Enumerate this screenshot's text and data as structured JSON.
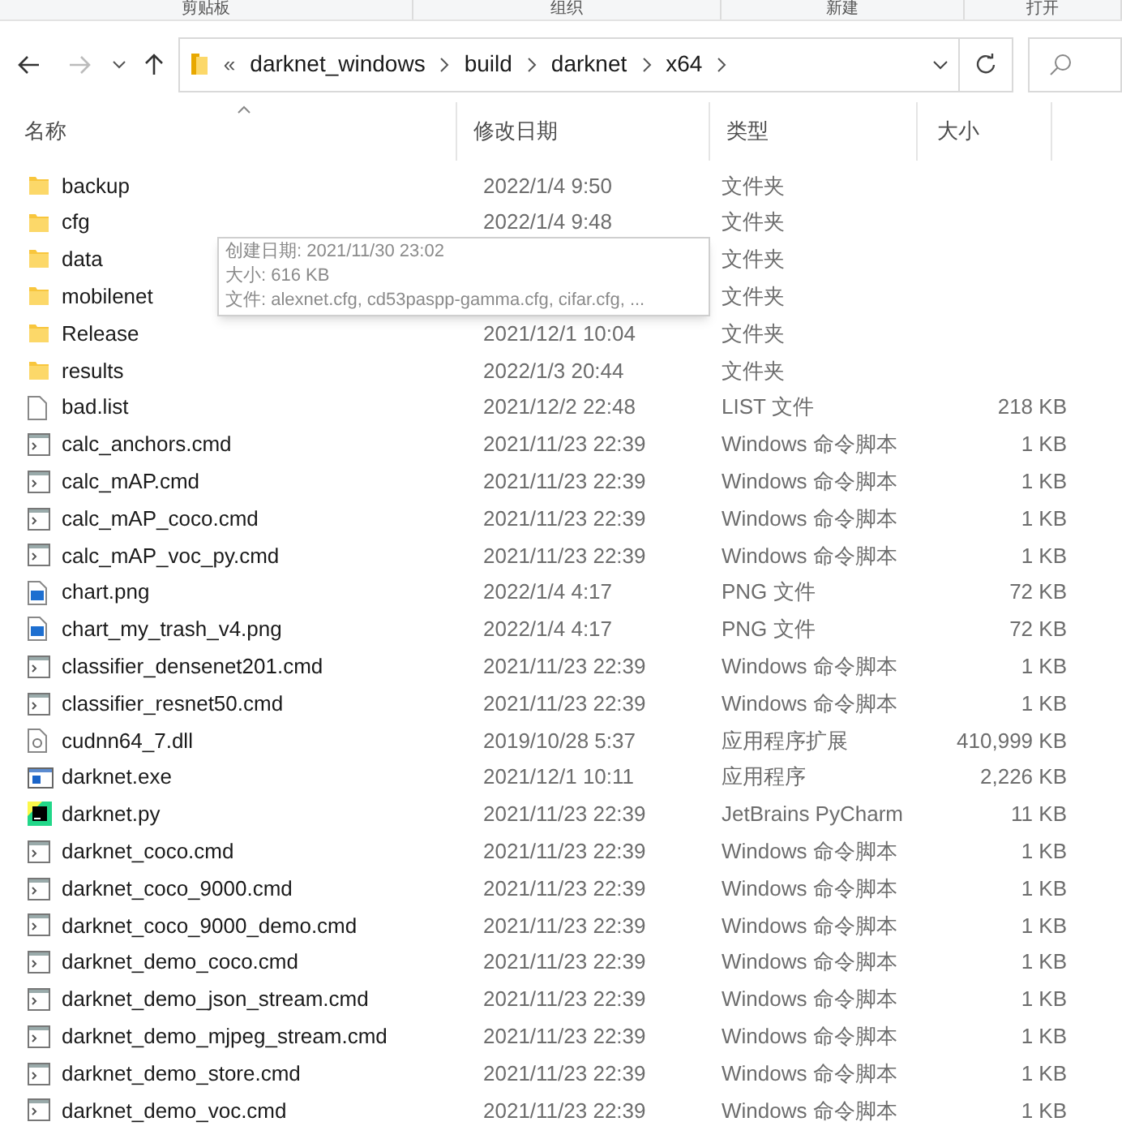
{
  "ribbon_groups": [
    "剪贴板",
    "组织",
    "新建",
    "打开"
  ],
  "address_bar": {
    "overflow": "«",
    "path": [
      "darknet_windows",
      "build",
      "darknet",
      "x64"
    ]
  },
  "columns": [
    "名称",
    "修改日期",
    "类型",
    "大小"
  ],
  "files": [
    {
      "kind": "folder",
      "name": "backup",
      "modified": "2022/1/4 9:50",
      "type": "文件夹"
    },
    {
      "kind": "folder",
      "name": "cfg",
      "modified": "2022/1/4 9:48",
      "type": "文件夹"
    },
    {
      "kind": "folder",
      "name": "data",
      "type": "文件夹"
    },
    {
      "kind": "folder",
      "name": "mobilenet",
      "type": "文件夹"
    },
    {
      "kind": "folder",
      "name": "Release",
      "modified": "2021/12/1 10:04",
      "type": "文件夹"
    },
    {
      "kind": "folder",
      "name": "results",
      "modified": "2022/1/3 20:44",
      "type": "文件夹"
    },
    {
      "kind": "file",
      "name": "bad.list",
      "modified": "2021/12/2 22:48",
      "type": "LIST 文件",
      "size": "218 KB"
    },
    {
      "kind": "script",
      "name": "calc_anchors.cmd",
      "modified": "2021/11/23 22:39",
      "type": "Windows 命令脚本",
      "size": "1 KB"
    },
    {
      "kind": "script",
      "name": "calc_mAP.cmd",
      "modified": "2021/11/23 22:39",
      "type": "Windows 命令脚本",
      "size": "1 KB"
    },
    {
      "kind": "script",
      "name": "calc_mAP_coco.cmd",
      "modified": "2021/11/23 22:39",
      "type": "Windows 命令脚本",
      "size": "1 KB"
    },
    {
      "kind": "script",
      "name": "calc_mAP_voc_py.cmd",
      "modified": "2021/11/23 22:39",
      "type": "Windows 命令脚本",
      "size": "1 KB"
    },
    {
      "kind": "image",
      "name": "chart.png",
      "modified": "2022/1/4 4:17",
      "type": "PNG 文件",
      "size": "72 KB"
    },
    {
      "kind": "image",
      "name": "chart_my_trash_v4.png",
      "modified": "2022/1/4 4:17",
      "type": "PNG 文件",
      "size": "72 KB"
    },
    {
      "kind": "script",
      "name": "classifier_densenet201.cmd",
      "modified": "2021/11/23 22:39",
      "type": "Windows 命令脚本",
      "size": "1 KB"
    },
    {
      "kind": "script",
      "name": "classifier_resnet50.cmd",
      "modified": "2021/11/23 22:39",
      "type": "Windows 命令脚本",
      "size": "1 KB"
    },
    {
      "kind": "library",
      "name": "cudnn64_7.dll",
      "modified": "2019/10/28 5:37",
      "type": "应用程序扩展",
      "size": "410,999 KB"
    },
    {
      "kind": "app",
      "name": "darknet.exe",
      "modified": "2021/12/1 10:11",
      "type": "应用程序",
      "size": "2,226 KB"
    },
    {
      "kind": "python",
      "name": "darknet.py",
      "modified": "2021/11/23 22:39",
      "type": "JetBrains PyCharm",
      "size": "11 KB"
    },
    {
      "kind": "script",
      "name": "darknet_coco.cmd",
      "modified": "2021/11/23 22:39",
      "type": "Windows 命令脚本",
      "size": "1 KB"
    },
    {
      "kind": "script",
      "name": "darknet_coco_9000.cmd",
      "modified": "2021/11/23 22:39",
      "type": "Windows 命令脚本",
      "size": "1 KB"
    },
    {
      "kind": "script",
      "name": "darknet_coco_9000_demo.cmd",
      "modified": "2021/11/23 22:39",
      "type": "Windows 命令脚本",
      "size": "1 KB"
    },
    {
      "kind": "script",
      "name": "darknet_demo_coco.cmd",
      "modified": "2021/11/23 22:39",
      "type": "Windows 命令脚本",
      "size": "1 KB"
    },
    {
      "kind": "script",
      "name": "darknet_demo_json_stream.cmd",
      "modified": "2021/11/23 22:39",
      "type": "Windows 命令脚本",
      "size": "1 KB"
    },
    {
      "kind": "script",
      "name": "darknet_demo_mjpeg_stream.cmd",
      "modified": "2021/11/23 22:39",
      "type": "Windows 命令脚本",
      "size": "1 KB"
    },
    {
      "kind": "script",
      "name": "darknet_demo_store.cmd",
      "modified": "2021/11/23 22:39",
      "type": "Windows 命令脚本",
      "size": "1 KB"
    },
    {
      "kind": "script",
      "name": "darknet_demo_voc.cmd",
      "modified": "2021/11/23 22:39",
      "type": "Windows 命令脚本",
      "size": "1 KB"
    }
  ],
  "tooltip": {
    "lines": [
      "创建日期: 2021/11/30 23:02",
      "大小: 616 KB",
      "文件: alexnet.cfg, cd53paspp-gamma.cfg, cifar.cfg, ..."
    ]
  }
}
